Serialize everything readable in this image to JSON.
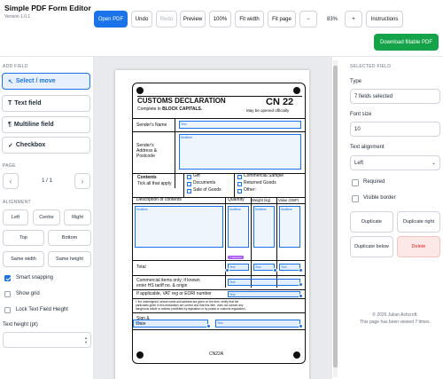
{
  "app": {
    "title": "Simple PDF Form Editor",
    "version": "Version 1.0.1"
  },
  "toolbar": {
    "open_pdf": "Open PDF",
    "undo": "Undo",
    "redo": "Redo",
    "preview": "Preview",
    "zoom_100": "100%",
    "fit_width": "Fit width",
    "fit_page": "Fit page",
    "zoom_out": "−",
    "zoom_level": "83%",
    "zoom_in": "+",
    "instructions": "Instructions",
    "download": "Download fillable PDF"
  },
  "left": {
    "add_field_heading": "ADD FIELD",
    "tools": [
      {
        "icon": "↖",
        "label": "Select / move"
      },
      {
        "icon": "T",
        "label": "Text field"
      },
      {
        "icon": "¶",
        "label": "Multiline field"
      },
      {
        "icon": "✓",
        "label": "Checkbox"
      }
    ],
    "page_heading": "PAGE",
    "page_prev": "‹",
    "page_label": "1 / 1",
    "page_next": "›",
    "alignment_heading": "ALIGNMENT",
    "align": {
      "left": "Left",
      "centre": "Centre",
      "right": "Right",
      "top": "Top",
      "bottom": "Bottom",
      "same_width": "Same width",
      "same_height": "Same height"
    },
    "smart_snapping": "Smart snapping",
    "show_grid": "Show grid",
    "lock_height": "Lock Text Field Height",
    "text_height_label": "Text height (pt)",
    "text_height_value": ""
  },
  "form": {
    "title": "CUSTOMS DECLARATION",
    "code": "CN 22",
    "subtitle_pre": "Complete in ",
    "subtitle_bold": "BLOCK CAPITALS.",
    "opened": "May be opened officially",
    "senders_name": "Sender's Name",
    "senders_address": "Sender's\nAddress &\nPostcode",
    "contents": "Contents",
    "tick": "Tick all that apply",
    "gift": "Gift",
    "documents": "Documents",
    "sale": "Sale of Goods",
    "commercial": "Commercial Sample",
    "returned": "Returned Goods",
    "other": "Other:",
    "desc_header": "Description of contents",
    "qty_header": "Quantity",
    "weight_header": "Weight (kg)",
    "value_header": "Value (GBP)",
    "total": "Total",
    "commercial_only": "Commercial items only; if known\nenter HS tariff no. & origin",
    "vat": "If applicable, VAT reg or EORI number",
    "declaration": "I, the undersigned, whose name and address are given on the item, certify that the\nparticulars given in this declaration are correct and that this item  does not contain any\ndangerous article or articles prohibited by legislation or by postal or customs regulations.",
    "sign_date": "Sign &\nDate",
    "footer_code": "CN22A",
    "field_text": "Text",
    "field_multiline": "Multiline",
    "selected_tag": "7 selected"
  },
  "right": {
    "heading": "SELECTED FIELD",
    "type_label": "Type",
    "type_value": "7 fields selected",
    "font_size_label": "Font size",
    "font_size_value": "10",
    "align_label": "Text alignment",
    "align_value": "Left",
    "required": "Required",
    "visible_border": "Visible border",
    "duplicate": "Duplicate",
    "duplicate_right": "Duplicate right",
    "duplicate_below": "Duplicate below",
    "delete": "Delete",
    "copyright": "© 2026 Julian Ashcroft.",
    "views": "This page has been viewed 7 times."
  },
  "colors": {
    "primary": "#1a73e8",
    "success": "#15a34a",
    "danger": "#dc2626"
  }
}
